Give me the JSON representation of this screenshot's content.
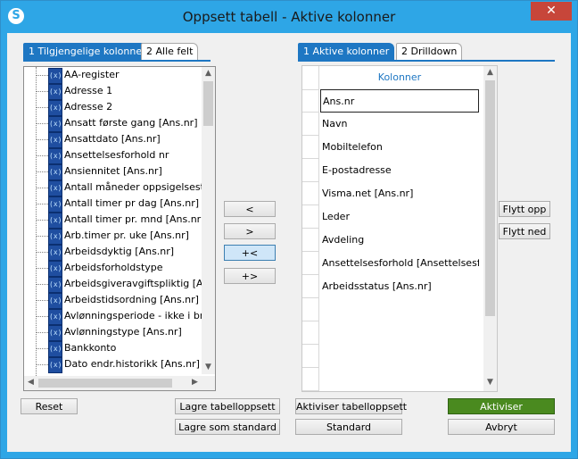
{
  "window": {
    "title": "Oppsett tabell - Aktive kolonner",
    "close_glyph": "✕",
    "app_icon": "S"
  },
  "left_tabs": [
    {
      "label": "1 Tilgjengelige kolonner",
      "active": true
    },
    {
      "label": "2 Alle felt",
      "active": false
    }
  ],
  "right_tabs": [
    {
      "label": "1 Aktive kolonner",
      "active": true
    },
    {
      "label": "2 Drilldown",
      "active": false
    }
  ],
  "available_columns": [
    "AA-register",
    "Adresse 1",
    "Adresse 2",
    "Ansatt første gang [Ans.nr]",
    "Ansattdato [Ans.nr]",
    "Ansettelsesforhold nr",
    "Ansiennitet [Ans.nr]",
    "Antall måneder oppsigelsestid [Ans",
    "Antall timer pr dag [Ans.nr]",
    "Antall timer pr. mnd [Ans.nr]",
    "Arb.timer pr. uke [Ans.nr]",
    "Arbeidsdyktig [Ans.nr]",
    "Arbeidsforholdstype",
    "Arbeidsgiveravgiftspliktig [Ans.nr",
    "Arbeidstidsordning [Ans.nr]",
    "Avlønningsperiode - ikke i bruk [A",
    "Avlønningstype [Ans.nr]",
    "Bankkonto",
    "Dato endr.historikk [Ans.nr]"
  ],
  "tree_icon_glyph": "(x)",
  "move_buttons": [
    "<",
    ">",
    "+<",
    "+>"
  ],
  "grid": {
    "header": "Kolonner",
    "rows": [
      "Ans.nr",
      "Navn",
      "Mobiltelefon",
      "E-postadresse",
      "Visma.net [Ans.nr]",
      "Leder",
      "Avdeling",
      "Ansettelsesforhold [Ansettelsesfor",
      "Arbeidsstatus [Ans.nr]"
    ],
    "selected_row": 0
  },
  "order_buttons": {
    "up": "Flytt opp",
    "down": "Flytt ned"
  },
  "bottom_buttons": {
    "reset": "Reset",
    "save_layout": "Lagre tabelloppsett",
    "save_default": "Lagre som standard",
    "activate_layout": "Aktiviser tabelloppsett",
    "standard": "Standard",
    "activate": "Aktiviser",
    "cancel": "Avbryt"
  },
  "colors": {
    "titlebar": "#2ea6e6",
    "tab_active": "#1e77c3",
    "activate_button": "#4a8a1f",
    "close_button": "#c7463a"
  }
}
